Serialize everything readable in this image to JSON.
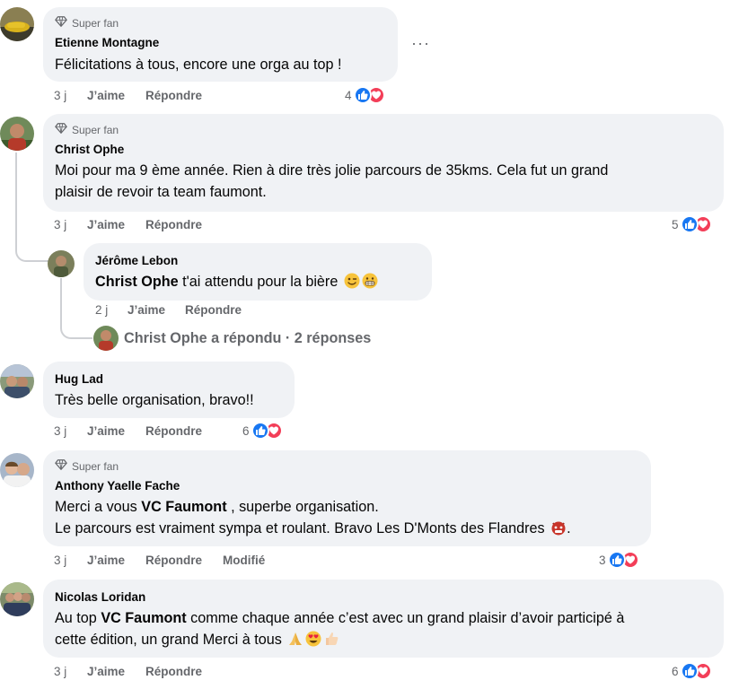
{
  "icons": {
    "badge": "diamond-icon",
    "like": "thumbs-up-icon",
    "love": "heart-icon",
    "more": "more-options-icon"
  },
  "colors": {
    "bubble": "#f0f2f5",
    "secondary_text": "#65676b",
    "like": "#1877f2",
    "love": "#f33e58"
  },
  "actions": {
    "like_label": "J’aime",
    "reply_label": "Répondre",
    "edited_label": "Modifié"
  },
  "comments": [
    {
      "badge": "Super fan",
      "author": "Etienne Montagne",
      "text": "Félicitations à tous, encore une orga au top !",
      "time": "3 j",
      "reactions_count": "4",
      "more": "···"
    },
    {
      "badge": "Super fan",
      "author": "Christ Ophe",
      "text_line1": "Moi pour ma 9 ème année. Rien à dire très jolie parcours de 35kms. Cela fut un grand",
      "text_line2": "plaisir de revoir ta team faumont.",
      "time": "3 j",
      "reactions_count": "5",
      "reply": {
        "author": "Jérôme Lebon",
        "mention": "Christ Ophe",
        "text": " t'ai attendu pour la bière ",
        "time": "2 j"
      },
      "replies_summary": "Christ Ophe a répondu · 2 réponses"
    },
    {
      "author": "Hug Lad",
      "text": "Très belle organisation, bravo!!",
      "time": "3 j",
      "reactions_count": "6"
    },
    {
      "badge": "Super fan",
      "author": "Anthony Yaelle Fache",
      "text_line1_pre": "Merci a vous ",
      "mention": "VC Faumont",
      "text_line1_post": " , superbe organisation.",
      "text_line2": "Le parcours est vraiment sympa et roulant. Bravo Les D'Monts des Flandres ",
      "text_line2_end": ".",
      "time": "3 j",
      "reactions_count": "3"
    },
    {
      "author": "Nicolas Loridan",
      "text_line1_pre": "Au top ",
      "mention": "VC Faumont",
      "text_line1_post": " comme chaque année c’est avec un grand plaisir d’avoir participé à",
      "text_line2": "cette édition, un grand Merci à tous ",
      "time": "3 j",
      "reactions_count": "6"
    }
  ]
}
